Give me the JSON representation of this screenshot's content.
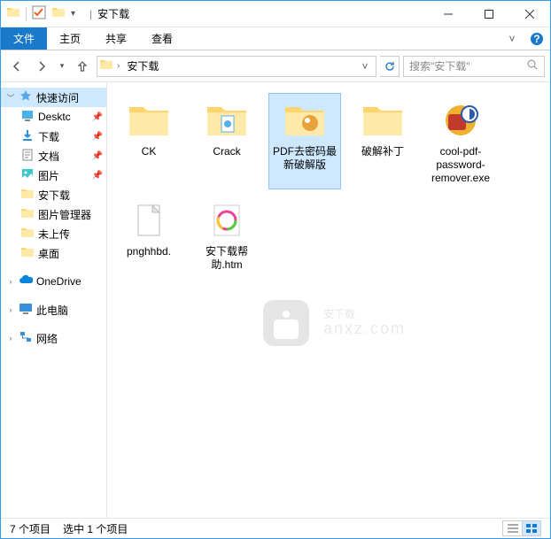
{
  "title": "安下载",
  "ribbon": {
    "file": "文件",
    "home": "主页",
    "share": "共享",
    "view": "查看"
  },
  "breadcrumb": {
    "current": "安下载"
  },
  "search": {
    "placeholder": "搜索\"安下载\""
  },
  "sidebar": {
    "quick": "快速访问",
    "items": [
      {
        "label": "Desktc"
      },
      {
        "label": "下载"
      },
      {
        "label": "文档"
      },
      {
        "label": "图片"
      },
      {
        "label": "安下载"
      },
      {
        "label": "图片管理器"
      },
      {
        "label": "未上传"
      },
      {
        "label": "桌面"
      }
    ],
    "onedrive": "OneDrive",
    "thispc": "此电脑",
    "network": "网络"
  },
  "files": [
    {
      "label": "CK",
      "type": "folder"
    },
    {
      "label": "Crack",
      "type": "folder-doc"
    },
    {
      "label": "PDF去密码最新破解版",
      "type": "folder-img",
      "selected": true
    },
    {
      "label": "破解补丁",
      "type": "folder"
    },
    {
      "label": "cool-pdf-password-remover.exe",
      "type": "exe"
    },
    {
      "label": "pnghhbd.",
      "type": "file"
    },
    {
      "label": "安下载帮助.htm",
      "type": "htm"
    }
  ],
  "status": {
    "count": "7 个项目",
    "selected": "选中 1 个项目"
  }
}
